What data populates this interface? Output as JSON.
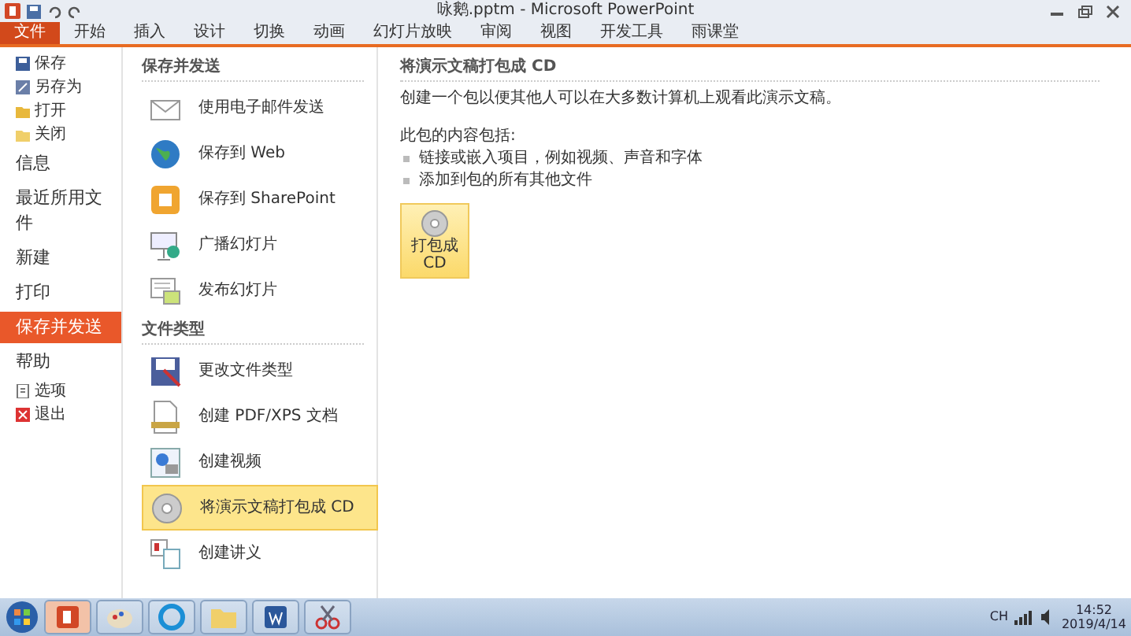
{
  "window": {
    "title": "咏鹅.pptm - Microsoft PowerPoint"
  },
  "ribbon_tabs": [
    {
      "label": "文件",
      "selected": true
    },
    {
      "label": "开始",
      "selected": false
    },
    {
      "label": "插入",
      "selected": false
    },
    {
      "label": "设计",
      "selected": false
    },
    {
      "label": "切换",
      "selected": false
    },
    {
      "label": "动画",
      "selected": false
    },
    {
      "label": "幻灯片放映",
      "selected": false
    },
    {
      "label": "审阅",
      "selected": false
    },
    {
      "label": "视图",
      "selected": false
    },
    {
      "label": "开发工具",
      "selected": false
    },
    {
      "label": "雨课堂",
      "selected": false
    }
  ],
  "backstage_nav": [
    {
      "label": "保存",
      "kind": "command",
      "selected": false
    },
    {
      "label": "另存为",
      "kind": "command",
      "selected": false
    },
    {
      "label": "打开",
      "kind": "command",
      "selected": false
    },
    {
      "label": "关闭",
      "kind": "command",
      "selected": false
    },
    {
      "label": "信息",
      "kind": "section",
      "selected": false
    },
    {
      "label": "最近所用文件",
      "kind": "section",
      "selected": false
    },
    {
      "label": "新建",
      "kind": "section",
      "selected": false
    },
    {
      "label": "打印",
      "kind": "section",
      "selected": false
    },
    {
      "label": "保存并发送",
      "kind": "section",
      "selected": true
    },
    {
      "label": "帮助",
      "kind": "section",
      "selected": false
    },
    {
      "label": "选项",
      "kind": "command",
      "selected": false
    },
    {
      "label": "退出",
      "kind": "command",
      "selected": false
    }
  ],
  "send_groups": [
    {
      "heading": "保存并发送",
      "items": [
        {
          "label": "使用电子邮件发送",
          "selected": false
        },
        {
          "label": "保存到 Web",
          "selected": false
        },
        {
          "label": "保存到 SharePoint",
          "selected": false
        },
        {
          "label": "广播幻灯片",
          "selected": false
        },
        {
          "label": "发布幻灯片",
          "selected": false
        }
      ]
    },
    {
      "heading": "文件类型",
      "items": [
        {
          "label": "更改文件类型",
          "selected": false
        },
        {
          "label": "创建 PDF/XPS 文档",
          "selected": false
        },
        {
          "label": "创建视频",
          "selected": false
        },
        {
          "label": "将演示文稿打包成 CD",
          "selected": true
        },
        {
          "label": "创建讲义",
          "selected": false
        }
      ]
    }
  ],
  "detail": {
    "title": "将演示文稿打包成 CD",
    "description": "创建一个包以便其他人可以在大多数计算机上观看此演示文稿。",
    "contents_label": "此包的内容包括:",
    "bullets": [
      "链接或嵌入项目，例如视频、声音和字体",
      "添加到包的所有其他文件"
    ],
    "button": "打包成 CD"
  },
  "taskbar": {
    "language": "CH",
    "time": "14:52",
    "date": "2019/4/14"
  }
}
